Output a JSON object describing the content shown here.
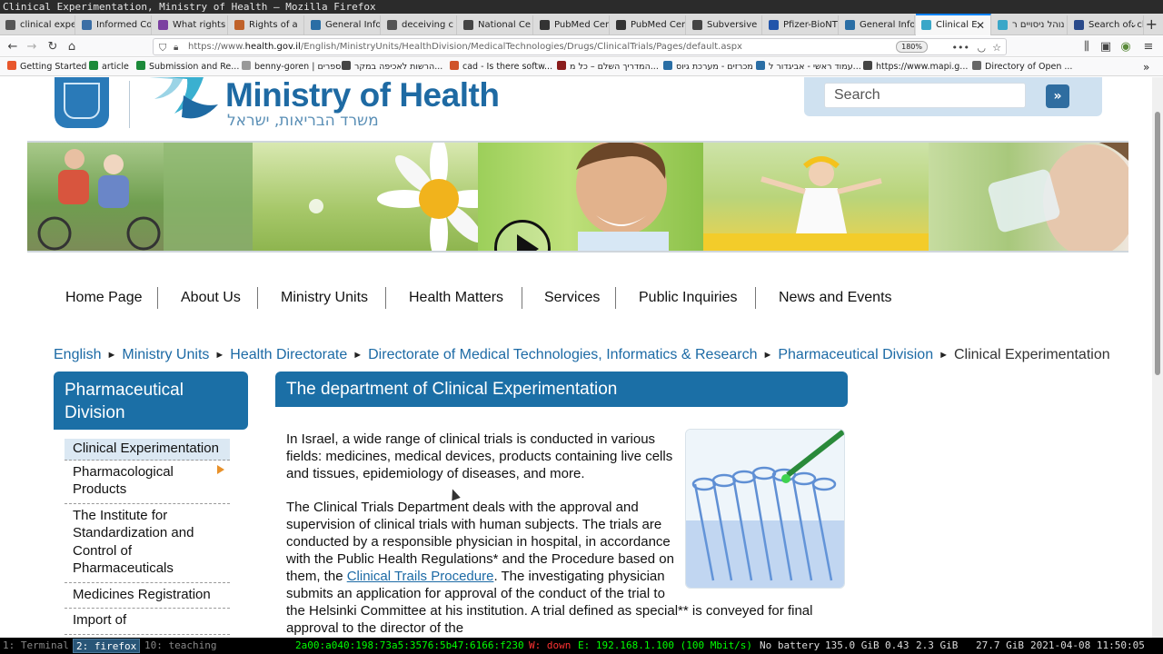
{
  "window": {
    "title": "Clinical Experimentation, Ministry of Health — Mozilla Firefox"
  },
  "tabs": [
    {
      "label": "clinical expe",
      "icon": "globe-icon",
      "color": "#555555"
    },
    {
      "label": "Informed Co",
      "icon": "page-icon",
      "color": "#3a6ea5"
    },
    {
      "label": "What rights",
      "icon": "page-icon",
      "color": "#7b3fa0"
    },
    {
      "label": "Rights of a",
      "icon": "page-icon",
      "color": "#c0622a"
    },
    {
      "label": "General Info",
      "icon": "page-icon",
      "color": "#2a6ea5"
    },
    {
      "label": "deceiving c",
      "icon": "globe-icon",
      "color": "#555555"
    },
    {
      "label": "National Ce",
      "icon": "page-icon",
      "color": "#444444"
    },
    {
      "label": "PubMed Cen",
      "icon": "page-icon",
      "color": "#333333"
    },
    {
      "label": "PubMed Cen",
      "icon": "page-icon",
      "color": "#333333"
    },
    {
      "label": "Subversive",
      "icon": "page-icon",
      "color": "#444444"
    },
    {
      "label": "Pfizer-BioNT",
      "icon": "page-icon",
      "color": "#2255aa"
    },
    {
      "label": "General Info",
      "icon": "page-icon",
      "color": "#2a6ea5"
    },
    {
      "label": "Clinical E",
      "icon": "bird-icon",
      "color": "#3aa7c8",
      "active": true
    },
    {
      "label": "נוהל ניסויים ר",
      "icon": "bird-icon",
      "color": "#3aa7c8"
    },
    {
      "label": "Search of: cl",
      "icon": "page-icon",
      "color": "#2a4a8a"
    }
  ],
  "navbar": {
    "url_prefix": "https://www.",
    "url_host": "health.gov.il",
    "url_path": "/English/MinistryUnits/HealthDivision/MedicalTechnologies/Drugs/ClinicalTrials/Pages/default.aspx",
    "zoom": "180%"
  },
  "bookmarks": [
    {
      "label": "Getting Started",
      "color": "#e8572c"
    },
    {
      "label": "article",
      "color": "#1c8a3a"
    },
    {
      "label": "Submission and Re...",
      "color": "#1c8a3a"
    },
    {
      "label": "benny-goren | ספרים",
      "color": "#999999"
    },
    {
      "label": "הרשות לאכיפה במקר...",
      "color": "#444444"
    },
    {
      "label": "cad - Is there softw...",
      "color": "#d0542a"
    },
    {
      "label": "המדריך השלם – כל מ...",
      "color": "#8a1c1c"
    },
    {
      "label": "מכרזים - מערכת גיוס",
      "color": "#2a6ea5"
    },
    {
      "label": "עמוד ראשי - אביגדור ל...",
      "color": "#2a6ea5"
    },
    {
      "label": "https://www.mapi.g...",
      "color": "#444444"
    },
    {
      "label": "Directory of Open ...",
      "color": "#666666"
    }
  ],
  "site": {
    "title": "Ministry of Health",
    "subtitle": "משרד הבריאות, ישראל",
    "search_placeholder": "Search",
    "search_button": "»"
  },
  "main_nav": [
    "Home Page",
    "About Us",
    "Ministry Units",
    "Health Matters",
    "Services",
    "Public Inquiries",
    "News and Events"
  ],
  "breadcrumb": {
    "links": [
      "English",
      "Ministry Units",
      "Health Directorate",
      "Directorate of Medical Technologies, Informatics & Research",
      "Pharmaceutical Division"
    ],
    "current": "Clinical Experimentation"
  },
  "sidebar": {
    "title": "Pharmaceutical Division",
    "items": [
      {
        "label": "Clinical Experimentation",
        "selected": true
      },
      {
        "label": "Pharmacological Products",
        "has_submenu": true
      },
      {
        "label": "The Institute for Standardization and Control of Pharmaceuticals"
      },
      {
        "label": "Medicines Registration"
      },
      {
        "label": "Import of"
      }
    ]
  },
  "content": {
    "heading": "The department of Clinical Experimentation",
    "p1": "In Israel, a wide range of clinical trials is conducted in various fields: medicines, medical devices, products containing live cells and tissues, epidemiology of diseases, and more.",
    "p2_before": "The Clinical Trials Department deals with the approval and supervision of clinical trials with human subjects. The trials are conducted by a responsible physician in hospital, in accordance with the Public Health Regulations* and the Procedure based on them, the ",
    "p2_link": "Clinical Trails Procedure",
    "p2_after": ". The investigating physician submits an application for approval of the conduct of the trial to the Helsinki Committee at his institution. A trial defined as special** is conveyed for final approval to the director of the"
  },
  "statusbar": {
    "ws1": "1: Terminal",
    "ws2": "2: firefox",
    "ws3": "10: teaching",
    "ipv6": "2a00:a040:198:73a5:3576:5b47:6166:f230",
    "wifi": "W: down",
    "eth": "E: 192.168.1.100 (100 Mbit/s)",
    "battery": "No battery",
    "disk": "135.0 GiB",
    "load": "0.43",
    "mem1": "2.3 GiB",
    "mem2": "27.7 GiB",
    "datetime": "2021-04-08 11:50:05"
  }
}
